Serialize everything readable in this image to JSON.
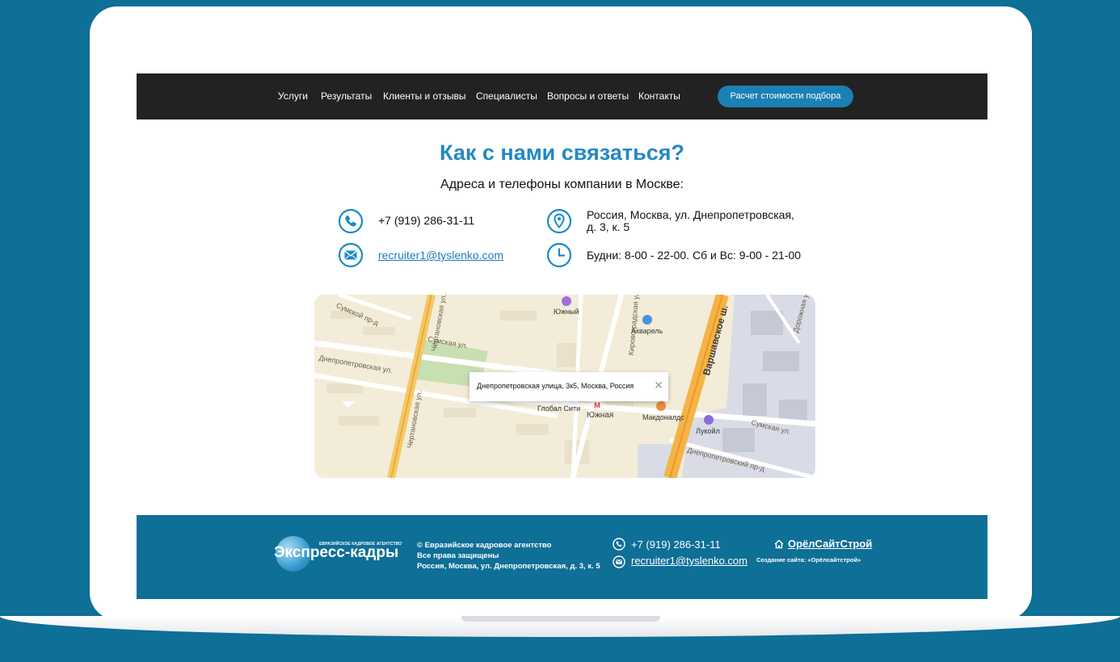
{
  "nav": {
    "items": [
      "Услуги",
      "Результаты",
      "Клиенты и отзывы",
      "Специалисты",
      "Вопросы и ответы",
      "Контакты"
    ],
    "cta_label": "Расчет стоимости подбора"
  },
  "contacts": {
    "title": "Как с нами связаться?",
    "subtitle": "Адреса и телефоны компании в Москве:",
    "phone": "+7 (919) 286-31-11",
    "email": "recruiter1@tyslenko.com",
    "address_line1": "Россия, Москва, ул. Днепропетровская,",
    "address_line2": "д. 3, к. 5",
    "hours": "Будни: 8-00 - 22-00. Сб и Вс: 9-00 - 21-00",
    "icons": [
      "phone-icon",
      "map-pin-icon",
      "mail-icon",
      "clock-icon"
    ]
  },
  "map": {
    "popup_text": "Днепропетровская улица, 3к5, Москва, Россия",
    "streets": [
      "Сумской пр-д",
      "Сумская ул.",
      "Днепропетровская ул.",
      "Чертановская ул.",
      "Чертановская ул.",
      "Кировоградская ул.",
      "Варшавское ш.",
      "Сумская ул.",
      "Днепропетровский пр-д",
      "Дорожная ул."
    ],
    "places": [
      "Южный",
      "Акварель",
      "Глобал Сити",
      "Южная",
      "Макдоналдс",
      "Лукойл"
    ]
  },
  "footer": {
    "logo_small": "ЕВРАЗИЙСКОЕ КАДРОВОЕ АГЕНТСТВО",
    "logo_big": "Экспресс-кадры",
    "copyright": "© Евразийское кадровое агентство",
    "rights": "Все права защищены",
    "address": "Россия, Москва, ул. Днепропетровская, д. 3, к. 5",
    "phone": "+7 (919) 286-31-11",
    "email": "recruiter1@tyslenko.com",
    "developer": "ОрёлСайтСтрой",
    "developer_sub": "Создание сайта: «Орёлсайтстрой»"
  },
  "colors": {
    "background": "#0e6f97",
    "accent": "#2389c2",
    "nav": "#222222",
    "cta": "#1b80b3"
  }
}
